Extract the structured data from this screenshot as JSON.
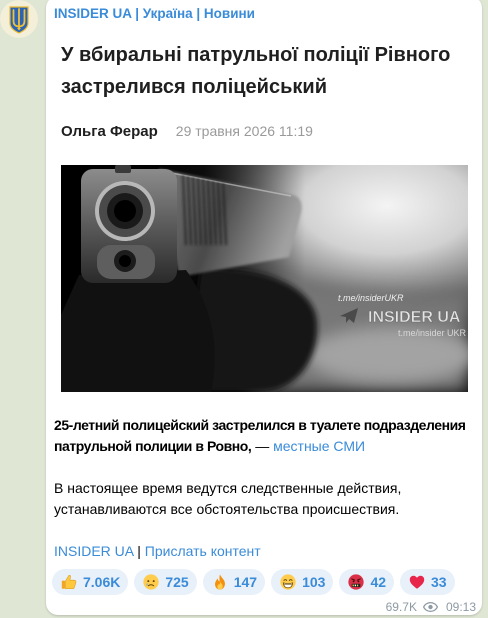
{
  "channel": {
    "header": "INSIDER UA | Україна | Новини",
    "avatar_icon": "ukraine-trident-icon"
  },
  "article": {
    "title": "У вбиральні патрульної поліції Рівного застрелився поліцейський",
    "author": "Ольга Ферар",
    "date": "29 травня 2026 11:19",
    "image": {
      "subject_icon": "pistol-photo",
      "watermark_top": "t.me/insiderUKR",
      "watermark_icon": "telegram-plane-icon",
      "watermark_brand": "INSIDER UA",
      "watermark_bottom": "t.me/insider UKR"
    }
  },
  "post": {
    "lead_bold": "25-летний полицейский застрелился в туалете подразделения патрульной полиции в Ровно,",
    "lead_dash": " — ",
    "lead_link": "местные СМИ",
    "body": "В настоящее время ведутся следственные действия, устанавливаются все обстоятельства происшествия.",
    "footer_link_1": "INSIDER UA",
    "footer_separator": " | ",
    "footer_link_2": "Прислать контент"
  },
  "reactions": [
    {
      "icon": "thumbs-up-icon",
      "count": "7.06K"
    },
    {
      "icon": "crying-face-icon",
      "count": "725"
    },
    {
      "icon": "fire-icon",
      "count": "147"
    },
    {
      "icon": "grinning-face-icon",
      "count": "103"
    },
    {
      "icon": "angry-symbols-face-icon",
      "count": "42"
    },
    {
      "icon": "red-heart-icon",
      "count": "33"
    }
  ],
  "meta": {
    "views": "69.7K",
    "views_icon": "eye-icon",
    "time": "09:13"
  },
  "colors": {
    "background": "#dfe6d4",
    "text": "#000000",
    "title": "#1f1f1f",
    "date": "#9a9a9a",
    "link": "#3a8bd8",
    "reaction_bg": "#e8f0fa",
    "meta": "#8d9aa3"
  }
}
